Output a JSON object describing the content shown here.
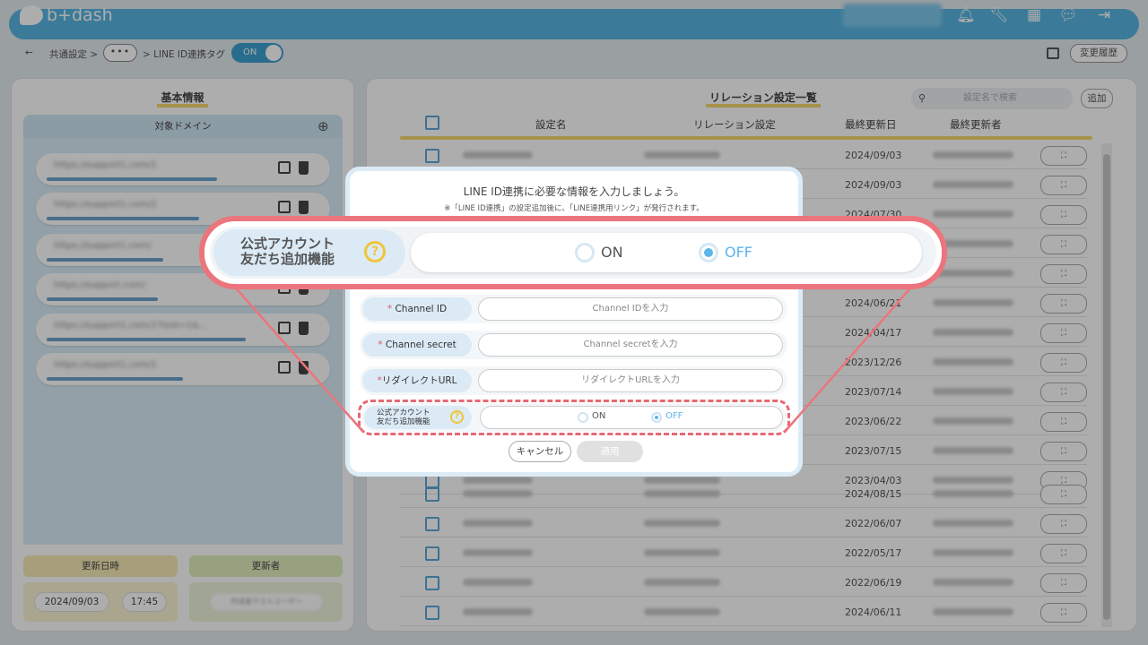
{
  "header": {
    "logo_text": "b+dash",
    "icons": [
      "bell-icon",
      "wrench-icon",
      "grid-icon",
      "chat-icon",
      "logout-icon"
    ]
  },
  "breadcrumb": {
    "back": "←",
    "item1": "共通設定 >",
    "dots": "•••",
    "item2": "> LINE ID連携タグ",
    "toggle": "ON",
    "history": "変更履歴"
  },
  "left": {
    "title": "基本情報",
    "domain_header": "対象ドメイン",
    "plus": "⊕",
    "domains": [
      "https://support1.com/1",
      "https://support1.com/2",
      "https://support1.com/",
      "https://support.com/",
      "https://support1.com/1?test=1&...",
      "https://support1.com/1"
    ],
    "updated_date_label": "更新日時",
    "updated_by_label": "更新者",
    "date": "2024/09/03",
    "time": "17:45",
    "user": "作成者テストユーザー"
  },
  "right": {
    "title": "リレーション設定一覧",
    "search_placeholder": "設定名で検索",
    "add": "追加",
    "columns": [
      "設定名",
      "リレーション設定",
      "最終更新日",
      "最終更新者"
    ],
    "action_icon": "⛶",
    "rows_top": [
      "2024/09/03",
      "2024/09/03",
      "2024/07/30",
      "",
      "",
      "2024/06/21",
      "2024/04/17",
      "2023/12/26",
      "2023/07/14",
      "2023/06/22",
      "2023/07/15",
      "2023/04/03"
    ],
    "rows_bottom": [
      "2024/08/15",
      "2022/06/07",
      "2022/05/17",
      "2022/06/19",
      "2024/06/11"
    ]
  },
  "modal": {
    "title": "LINE ID連携に必要な情報を入力しましょう。",
    "note": "※「LINE ID連携」の設定追加後に、「LINE連携用リンク」が発行されます。",
    "fields": [
      {
        "req": "*",
        "label": "Channel ID",
        "placeholder": "Channel IDを入力"
      },
      {
        "req": "*",
        "label": "Channel secret",
        "placeholder": "Channel secretを入力"
      },
      {
        "req": "*",
        "label": "リダイレクトURL",
        "placeholder": "リダイレクトURLを入力"
      }
    ],
    "friend_label_l1": "公式アカウント",
    "friend_label_l2": "友だち追加機能",
    "help": "?",
    "on": "ON",
    "off": "OFF",
    "cancel": "キャンセル",
    "apply": "適用"
  },
  "colors": {
    "brand": "#58b5e2",
    "highlight": "#ec757d",
    "accent_yellow": "#f6d86c"
  }
}
